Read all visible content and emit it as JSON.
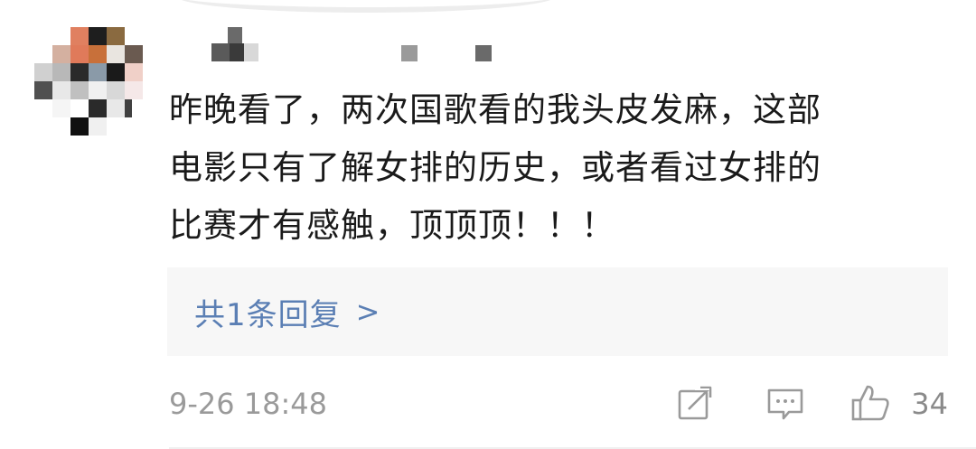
{
  "comment": {
    "text": "昨晚看了，两次国歌看的我头皮发麻，这部\n电影只有了解女排的历史，或者看过女排的\n比赛才有感触，顶顶顶！！！",
    "reply_link_label": "共1条回复",
    "reply_chevron": ">",
    "timestamp": "9-26 18:48",
    "like_count": "34"
  },
  "icons": {
    "share": "share-edit-icon",
    "comment": "comment-bubble-icon",
    "like": "thumbs-up-icon"
  },
  "colors": {
    "link": "#5b7fb4",
    "text": "#1a1a1a",
    "meta": "#9a9a9a",
    "reply_bg": "#f7f7f7"
  }
}
